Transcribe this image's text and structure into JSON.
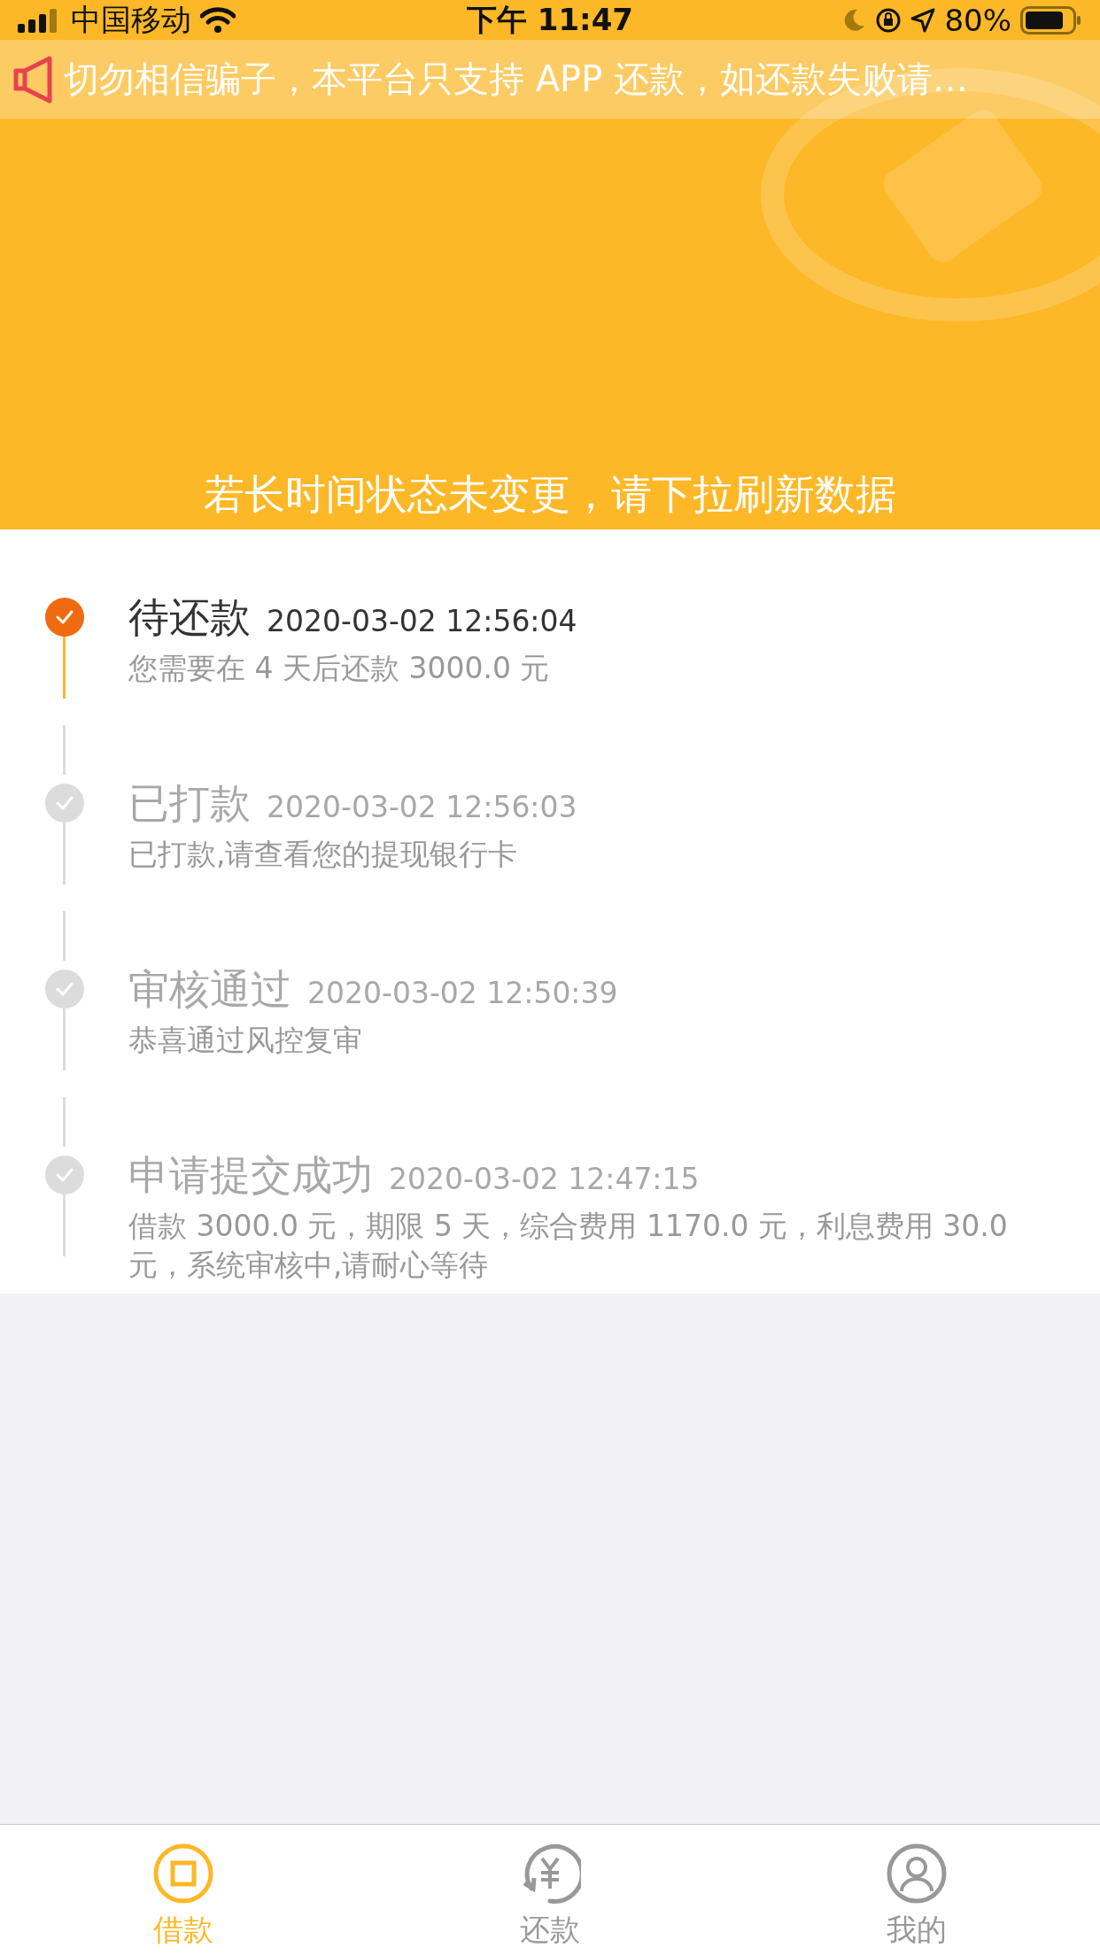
{
  "status_bar": {
    "carrier": "中国移动",
    "time": "下午 11:47",
    "battery": "80%"
  },
  "notice": {
    "text": "切勿相信骗子，本平台只支持 APP 还款，如还款失败请…"
  },
  "header": {
    "hint": "若长时间状态未变更，请下拉刷新数据"
  },
  "timeline": [
    {
      "title": "待还款",
      "time": "2020-03-02 12:56:04",
      "description": "您需要在 4 天后还款 3000.0 元",
      "selected": true
    },
    {
      "title": "已打款",
      "time": "2020-03-02 12:56:03",
      "description": "已打款,请查看您的提现银行卡",
      "selected": false
    },
    {
      "title": "审核通过",
      "time": "2020-03-02 12:50:39",
      "description": "恭喜通过风控复审",
      "selected": false
    },
    {
      "title": "申请提交成功",
      "time": "2020-03-02 12:47:15",
      "description": "借款 3000.0 元，期限 5 天，综合费用 1170.0 元，利息费用 30.0 元，系统审核中,请耐心等待",
      "selected": false
    }
  ],
  "tab_bar": [
    {
      "label": "借款",
      "kind": "borrow",
      "selected": true
    },
    {
      "label": "还款",
      "kind": "repay",
      "selected": false
    },
    {
      "label": "我的",
      "kind": "profile",
      "selected": false
    }
  ]
}
